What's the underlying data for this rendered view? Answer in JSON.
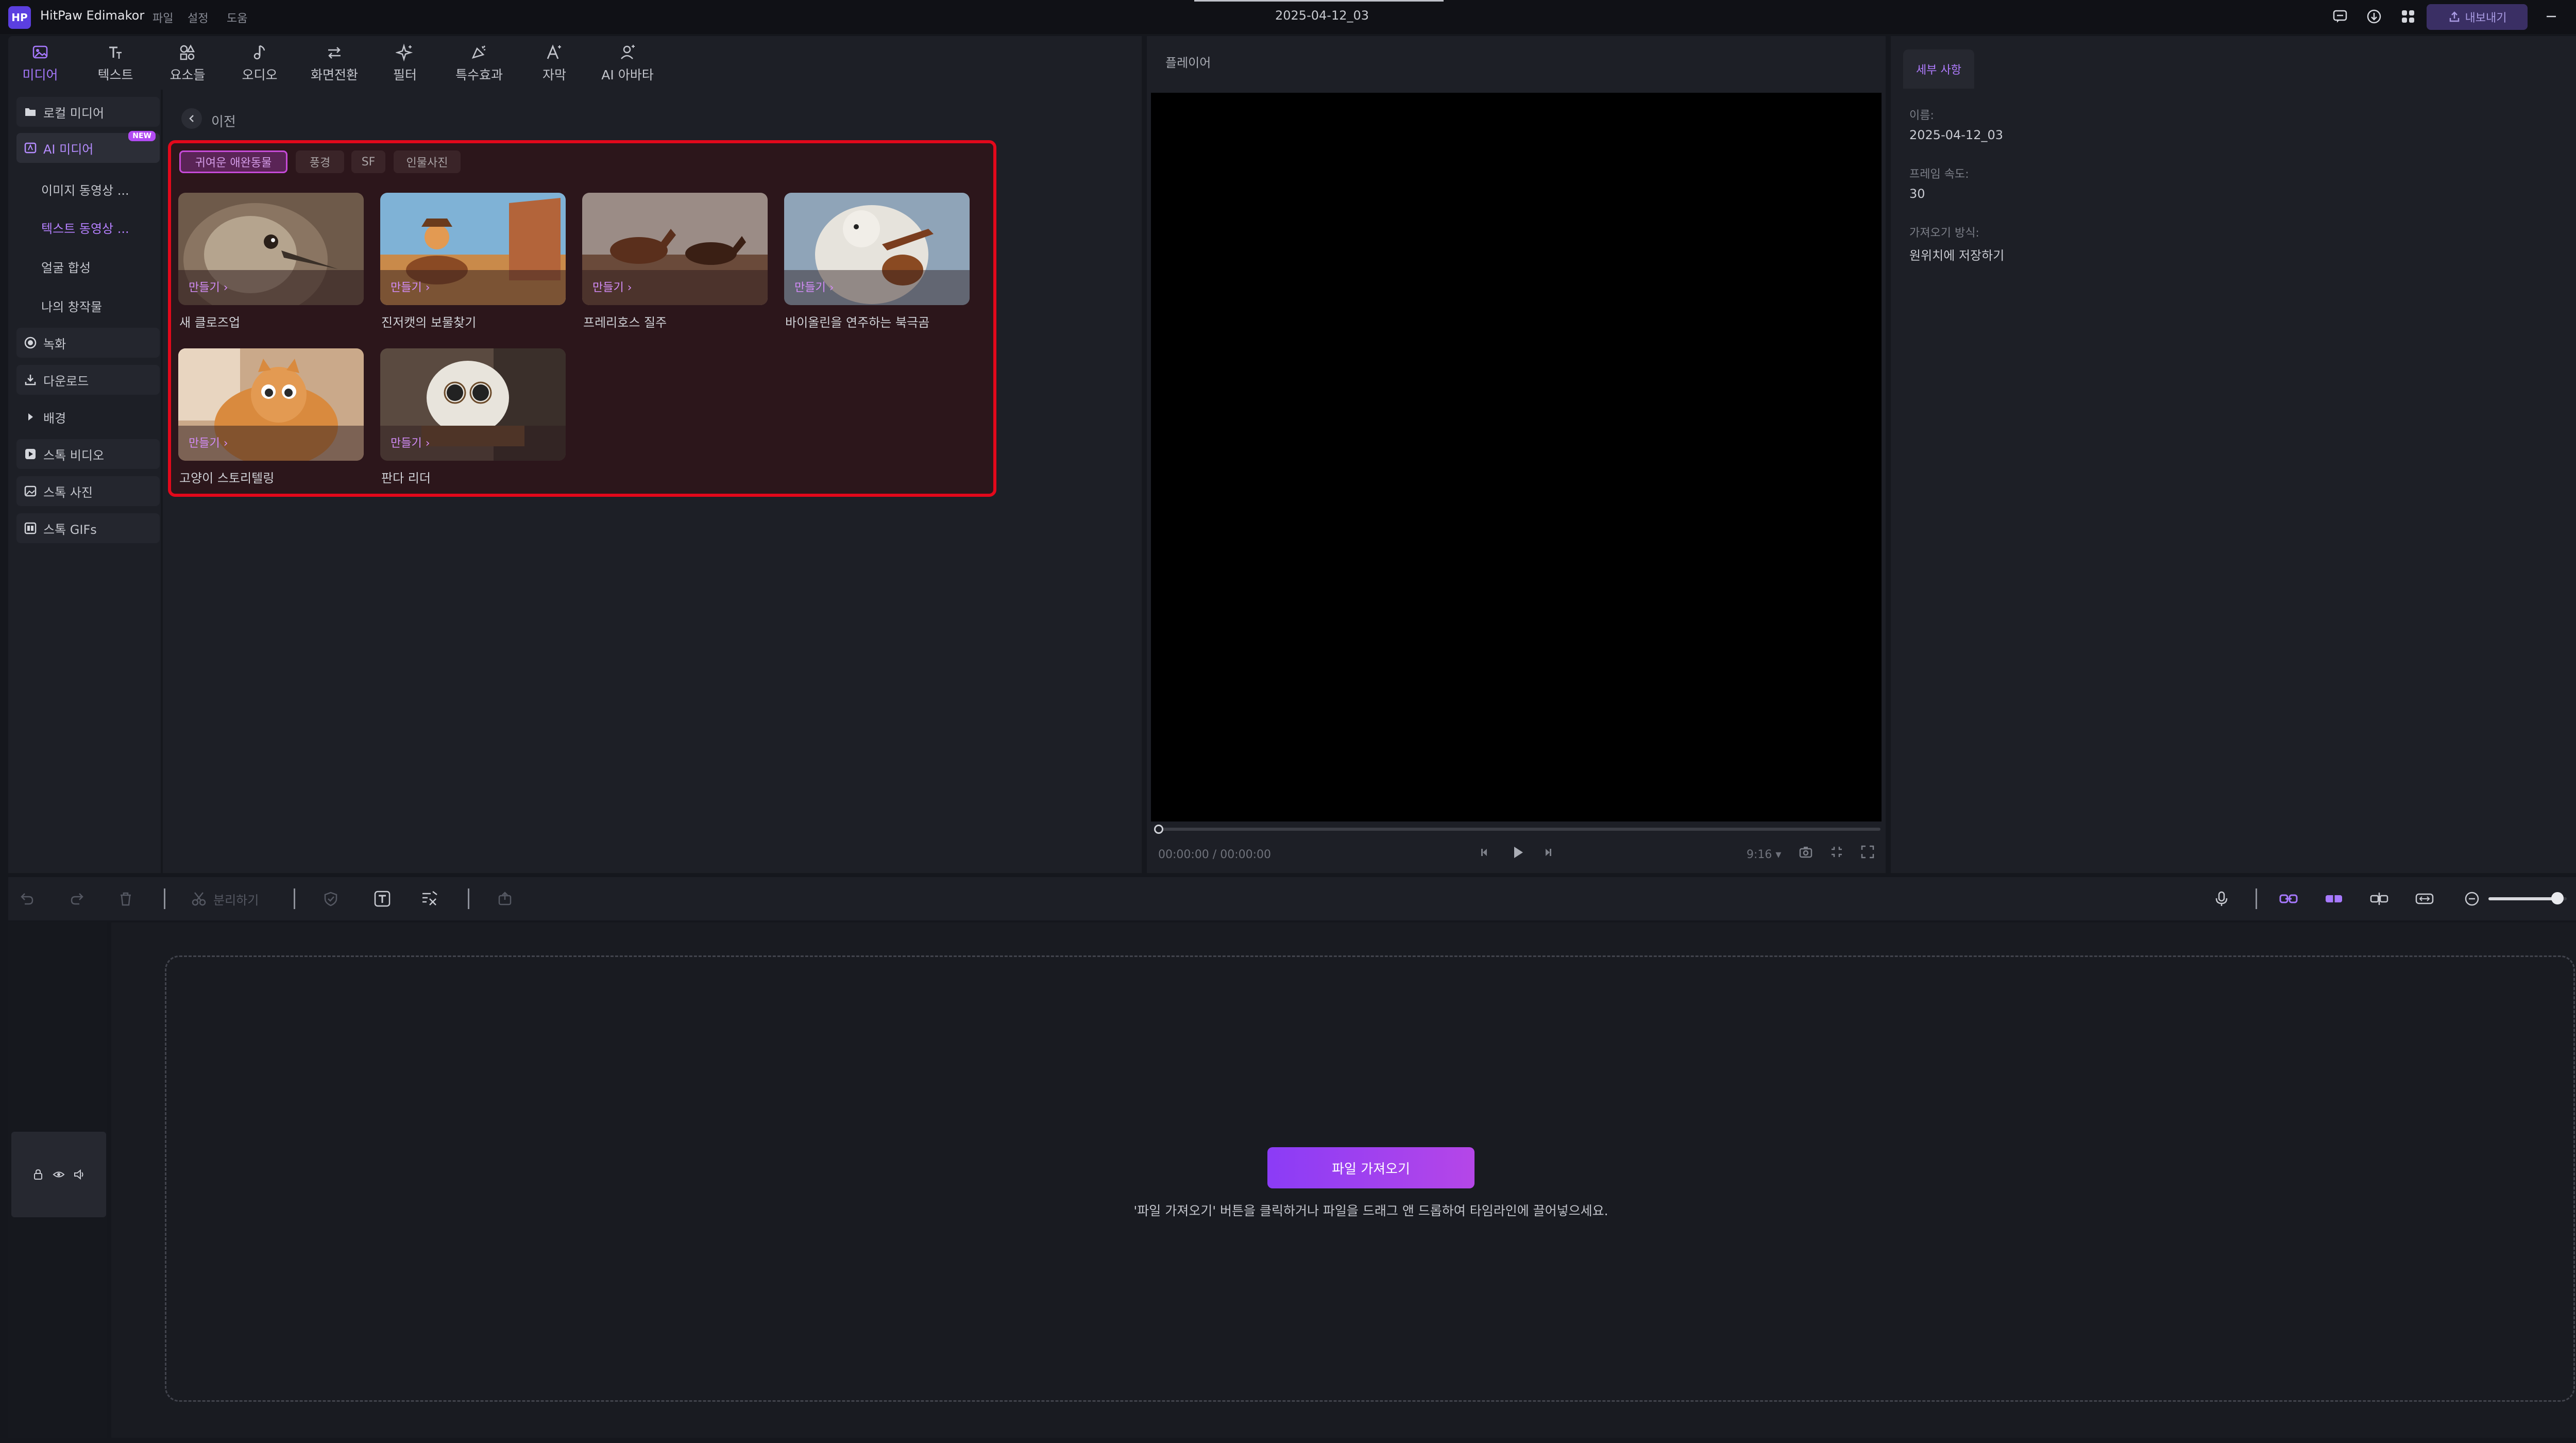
{
  "titlebar": {
    "logo": "HP",
    "app_name": "HitPaw Edimakor",
    "menu": [
      "파일",
      "설정",
      "도움"
    ],
    "document": "2025-04-12_03",
    "export_label": "내보내기"
  },
  "toolbar": {
    "tools": [
      {
        "label": "미디어",
        "icon": "media-icon",
        "active": true
      },
      {
        "label": "텍스트",
        "icon": "text-icon"
      },
      {
        "label": "요소들",
        "icon": "elements-icon"
      },
      {
        "label": "오디오",
        "icon": "audio-icon"
      },
      {
        "label": "화면전환",
        "icon": "transition-icon"
      },
      {
        "label": "필터",
        "icon": "filter-icon"
      },
      {
        "label": "특수효과",
        "icon": "effects-icon"
      },
      {
        "label": "자막",
        "icon": "subtitle-icon"
      },
      {
        "label": "AI 아바타",
        "icon": "ai-avatar-icon"
      }
    ]
  },
  "sidebar": {
    "local_media": "로컬 미디어",
    "ai_media": "AI 미디어",
    "new_badge": "NEW",
    "ai_sub": [
      "이미지 동영상 ...",
      "텍스트 동영상 ...",
      "얼굴 합성",
      "나의 창작물"
    ],
    "record": "녹화",
    "download": "다운로드",
    "background": "배경",
    "stock_video": "스톡 비디오",
    "stock_photo": "스톡 사진",
    "stock_gifs": "스톡 GIFs"
  },
  "media": {
    "back_label": "이전",
    "chips": [
      "귀여운 애완동물",
      "풍경",
      "SF",
      "인물사진"
    ],
    "selected_chip": 0,
    "make_label": "만들기",
    "cards": [
      {
        "title": "새 클로즈업"
      },
      {
        "title": "진저캣의 보물찾기"
      },
      {
        "title": "프레리호스 질주"
      },
      {
        "title": "바이올린을 연주하는 북극곰"
      },
      {
        "title": "고양이 스토리텔링"
      },
      {
        "title": "판다 리더"
      }
    ]
  },
  "player": {
    "title": "플레이어",
    "time": "00:00:00",
    "duration": "00:00:00",
    "ratio": "9:16"
  },
  "details": {
    "tab": "세부 사항",
    "name_label": "이름:",
    "name_value": "2025-04-12_03",
    "fps_label": "프레임 속도:",
    "fps_value": "30",
    "import_label": "가져오기 방식:",
    "import_value": "원위치에 저장하기"
  },
  "timeline": {
    "split_label": "분리하기",
    "import_button": "파일 가져오기",
    "hint": "'파일 가져오기' 버튼을 클릭하거나 파일을 드래그 앤 드롭하여 타임라인에 끌어넣으세요.",
    "zoom_level": 0.88
  },
  "colors": {
    "accent": "#a779ff",
    "highlight_border": "#e3081b"
  }
}
